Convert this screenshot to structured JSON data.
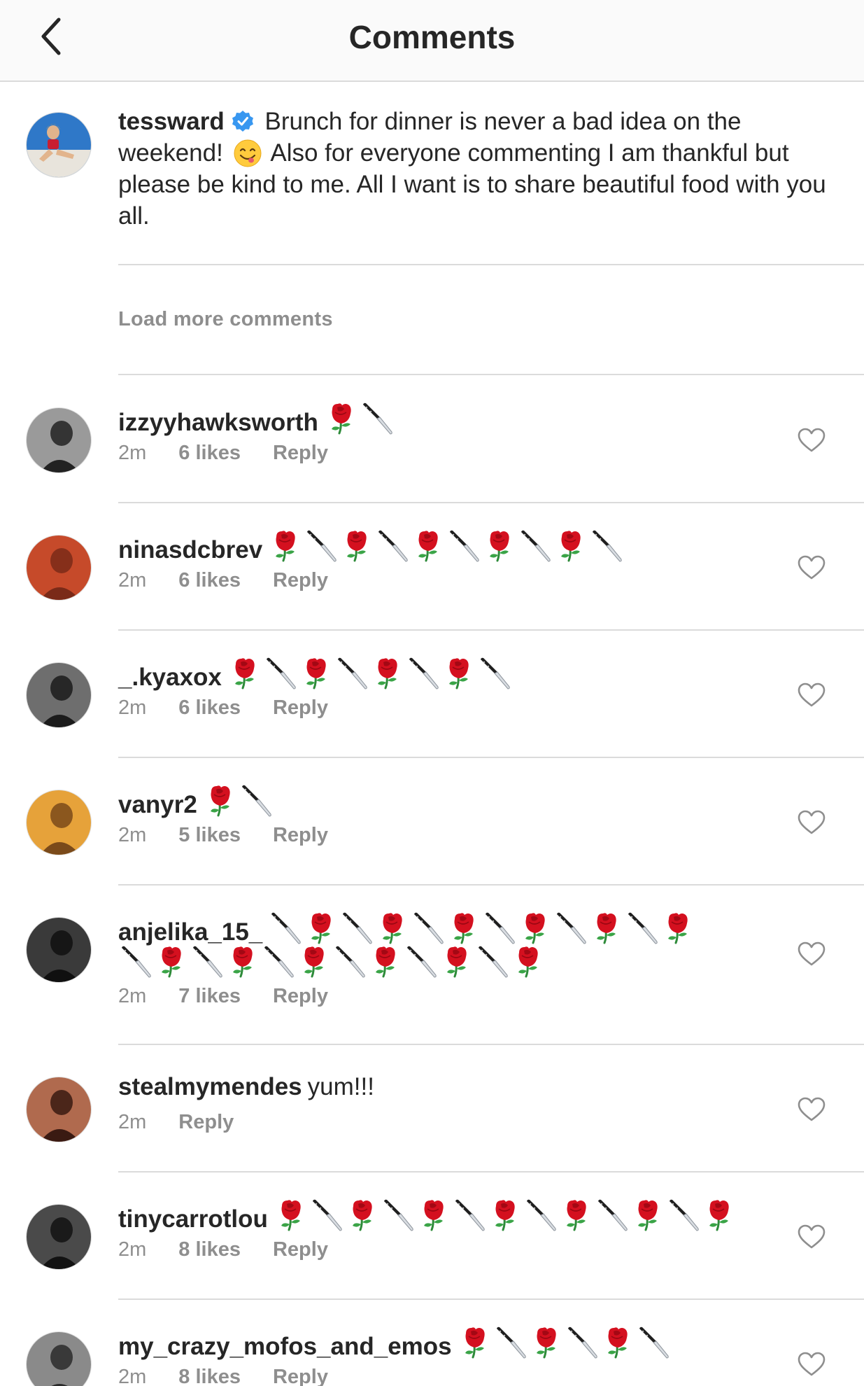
{
  "header": {
    "title": "Comments"
  },
  "caption": {
    "username": "tessward",
    "text_1": "Brunch for dinner is never a bad idea on the weekend!",
    "text_2": "Also for everyone commenting I am thankful but please be kind to me. All I want is to share beautiful food with you all."
  },
  "load_more": "Load more comments",
  "comments": [
    {
      "username": "izzyyhawksworth",
      "time": "2m",
      "likes": "6 likes",
      "reply": "Reply",
      "emoji": [
        "rose",
        "knife"
      ]
    },
    {
      "username": "ninasdcbrev",
      "time": "2m",
      "likes": "6 likes",
      "reply": "Reply",
      "emoji": [
        "rose",
        "knife",
        "rose",
        "knife",
        "rose",
        "knife",
        "rose",
        "knife",
        "rose",
        "knife"
      ]
    },
    {
      "username": "_.kyaxox",
      "time": "2m",
      "likes": "6 likes",
      "reply": "Reply",
      "emoji": [
        "rose",
        "knife",
        "rose",
        "knife",
        "rose",
        "knife",
        "rose",
        "knife"
      ]
    },
    {
      "username": "vanyr2",
      "time": "2m",
      "likes": "5 likes",
      "reply": "Reply",
      "emoji": [
        "rose",
        "knife"
      ]
    },
    {
      "username": "anjelika_15_",
      "time": "2m",
      "likes": "7 likes",
      "reply": "Reply",
      "emoji": [
        "knife",
        "rose",
        "knife",
        "rose",
        "knife",
        "rose",
        "knife",
        "rose",
        "knife",
        "rose",
        "knife",
        "rose"
      ],
      "emoji_line2": [
        "knife",
        "rose",
        "knife",
        "rose",
        "knife",
        "rose",
        "knife",
        "rose",
        "knife",
        "rose",
        "knife",
        "rose"
      ]
    },
    {
      "username": "stealmymendes",
      "text": "yum!!!",
      "time": "2m",
      "reply": "Reply"
    },
    {
      "username": "tinycarrotlou",
      "time": "2m",
      "likes": "8 likes",
      "reply": "Reply",
      "emoji": [
        "rose",
        "knife",
        "rose",
        "knife",
        "rose",
        "knife",
        "rose",
        "knife",
        "rose",
        "knife",
        "rose",
        "knife",
        "rose"
      ]
    },
    {
      "username": "my_crazy_mofos_and_emos",
      "time": "2m",
      "likes": "8 likes",
      "reply": "Reply",
      "emoji": [
        "rose",
        "knife",
        "rose",
        "knife",
        "rose",
        "knife"
      ]
    }
  ],
  "colors": {
    "text": "#262626",
    "muted": "#8e8e8e",
    "divider": "#dbdbdb",
    "verified": "#3897f0",
    "rose": "#d4101f"
  }
}
